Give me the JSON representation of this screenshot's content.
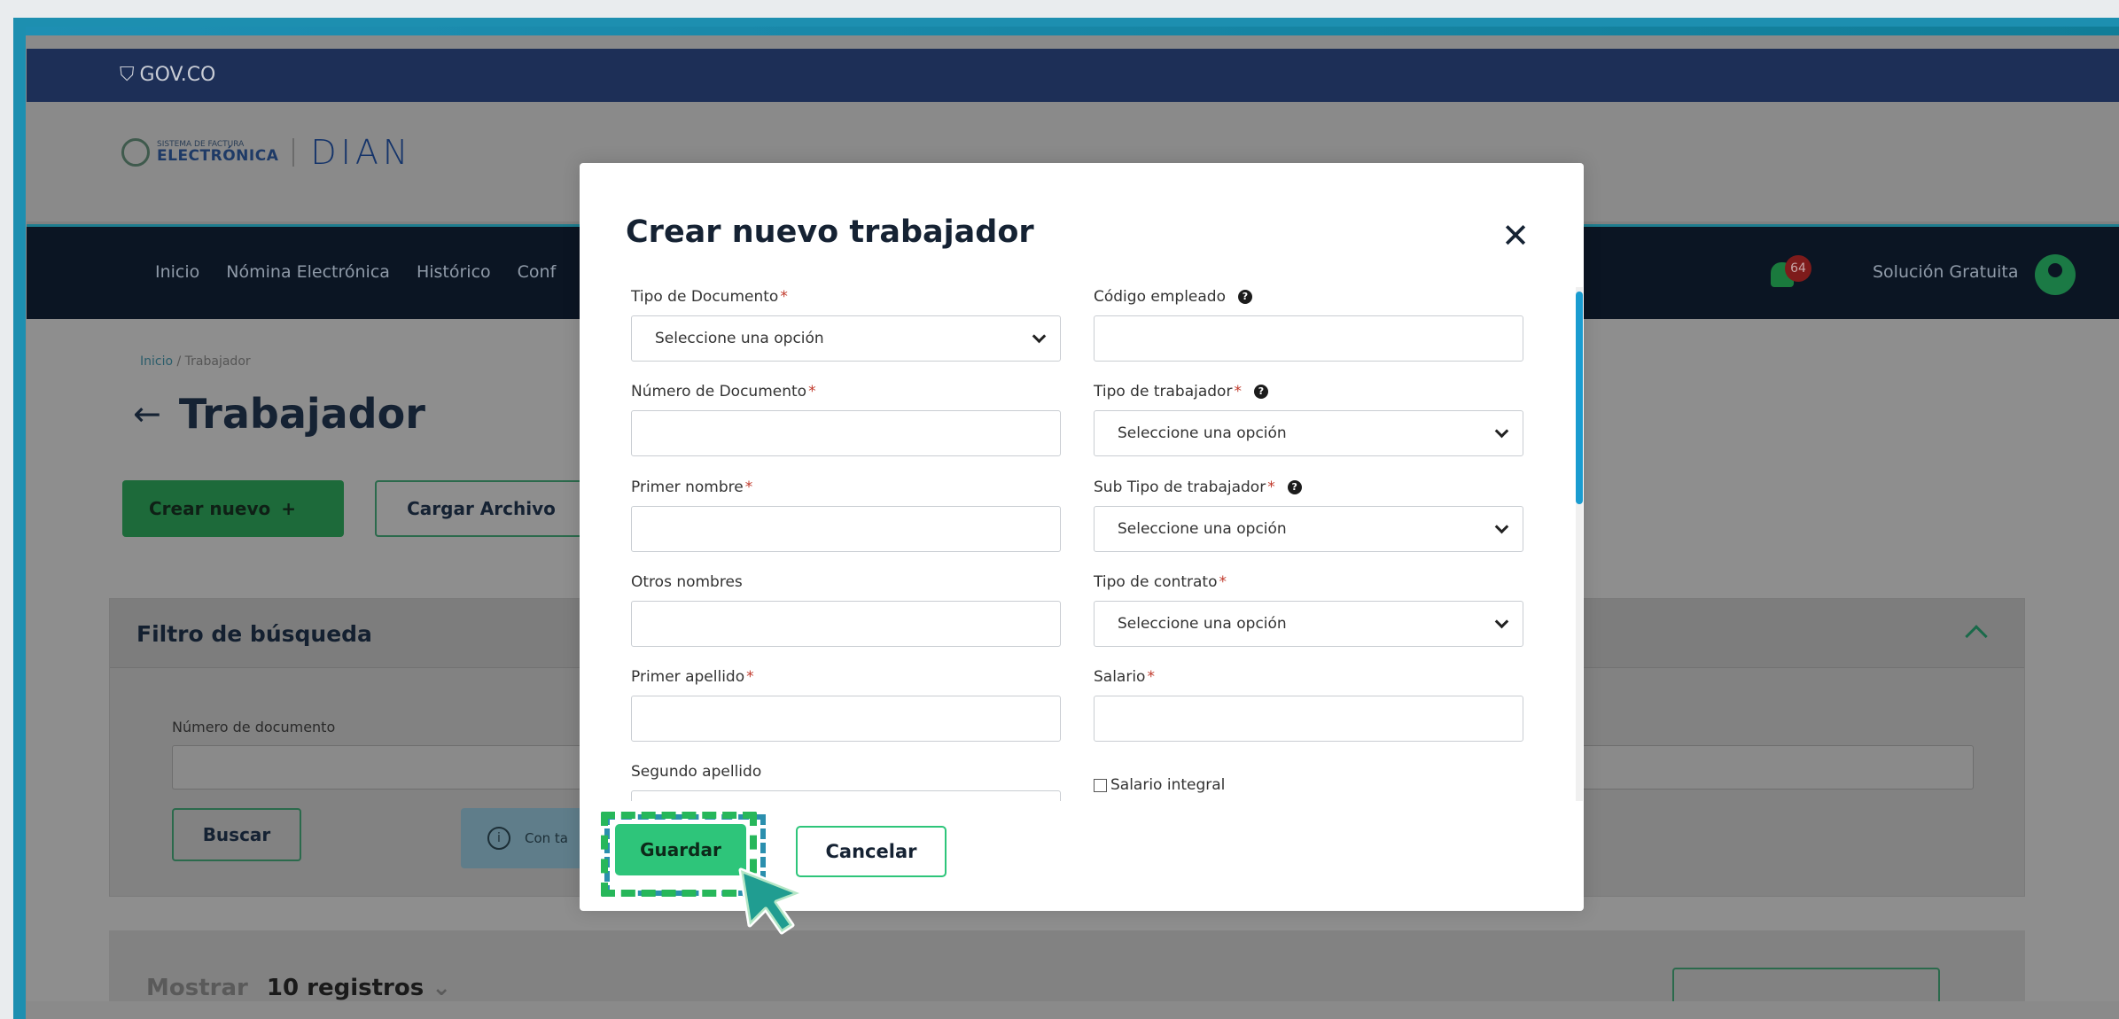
{
  "gov_bar": {
    "logo_text": "GOV.CO"
  },
  "brand": {
    "system_small": "SISTEMA DE FACTURA",
    "system_big": "ELECTRÓNICA",
    "dian_word": "DIAN"
  },
  "nav": {
    "items": [
      "Inicio",
      "Nómina Electrónica",
      "Histórico",
      "Conf"
    ],
    "notification_count": "64",
    "user_label": "Solución Gratuita"
  },
  "breadcrumb": {
    "home": "Inicio",
    "separator": "/",
    "current": "Trabajador"
  },
  "page_title": "Trabajador",
  "actions": {
    "create_label": "Crear nuevo",
    "create_icon": "+",
    "upload_label": "Cargar Archivo"
  },
  "filter": {
    "title": "Filtro de búsqueda",
    "doc_label": "Número de documento",
    "search_label": "Buscar",
    "info_text": "Con ta"
  },
  "list": {
    "show_label": "Mostrar",
    "records_select": "10 registros"
  },
  "modal": {
    "title": "Crear nuevo trabajador",
    "close_symbol": "✕",
    "left_fields": [
      {
        "label": "Tipo de Documento",
        "required": "*",
        "type": "select",
        "value": "Seleccione una opción"
      },
      {
        "label": "Número de Documento",
        "required": "*",
        "type": "text",
        "value": ""
      },
      {
        "label": "Primer nombre",
        "required": "*",
        "type": "text",
        "value": ""
      },
      {
        "label": "Otros nombres",
        "required": "",
        "type": "text",
        "value": ""
      },
      {
        "label": "Primer apellido",
        "required": "*",
        "type": "text",
        "value": ""
      },
      {
        "label": "Segundo apellido",
        "required": "",
        "type": "text",
        "value": ""
      }
    ],
    "right_fields": [
      {
        "label": "Código empleado",
        "required": "",
        "help": "?",
        "type": "text",
        "value": ""
      },
      {
        "label": "Tipo de trabajador",
        "required": "*",
        "help": "?",
        "type": "select",
        "value": "Seleccione una opción"
      },
      {
        "label": "Sub Tipo de trabajador",
        "required": "*",
        "help": "?",
        "type": "select",
        "value": "Seleccione una opción"
      },
      {
        "label": "Tipo de contrato",
        "required": "*",
        "type": "select",
        "value": "Seleccione una opción"
      },
      {
        "label": "Salario",
        "required": "*",
        "type": "text",
        "value": ""
      }
    ],
    "checkbox_label": "Salario integral",
    "save_label": "Guardar",
    "cancel_label": "Cancelar"
  },
  "colors": {
    "frame_accent": "#1d8fb0",
    "primary_green": "#2ec57a",
    "scroll_blue": "#1a9cd0",
    "required_red": "#c0392b"
  }
}
